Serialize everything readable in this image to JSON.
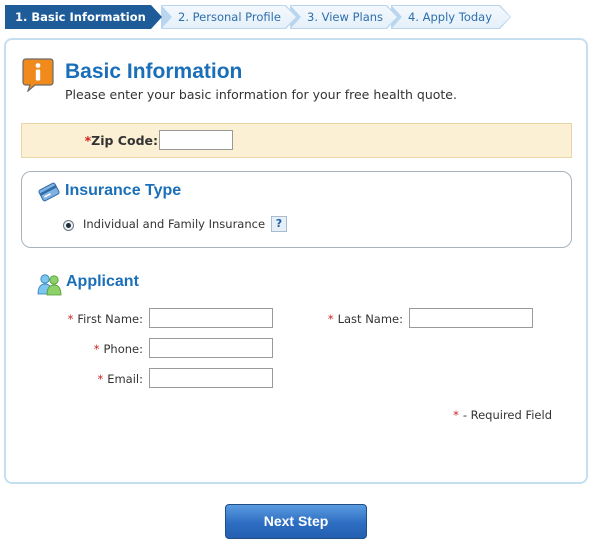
{
  "steps": [
    {
      "label": "1. Basic Information",
      "state": "active"
    },
    {
      "label": "2. Personal Profile",
      "state": "inactive"
    },
    {
      "label": "3. View Plans",
      "state": "inactive"
    },
    {
      "label": "4. Apply Today",
      "state": "inactive"
    }
  ],
  "header": {
    "icon": "info-icon",
    "title": "Basic Information",
    "subtitle": "Please enter your basic information for your free health quote."
  },
  "zip": {
    "required_mark": "*",
    "label": "Zip Code:",
    "value": ""
  },
  "insurance": {
    "icon": "insurance-card-icon",
    "title": "Insurance Type",
    "option_label": "Individual and Family Insurance",
    "option_selected": true,
    "help_label": "?"
  },
  "applicant": {
    "icon": "people-icon",
    "title": "Applicant",
    "required_mark": "*",
    "first_name_label": "First Name:",
    "first_name_value": "",
    "last_name_label": "Last Name:",
    "last_name_value": "",
    "phone_label": "Phone:",
    "phone_value": "",
    "email_label": "Email:",
    "email_value": ""
  },
  "required_note": {
    "mark": "*",
    "text": "- Required Field"
  },
  "next_button": {
    "label": "Next Step"
  },
  "colors": {
    "accent": "#1b6fb8",
    "step_active": "#1d5c99",
    "required": "#d02020",
    "zip_background": "#fbf0d3"
  }
}
